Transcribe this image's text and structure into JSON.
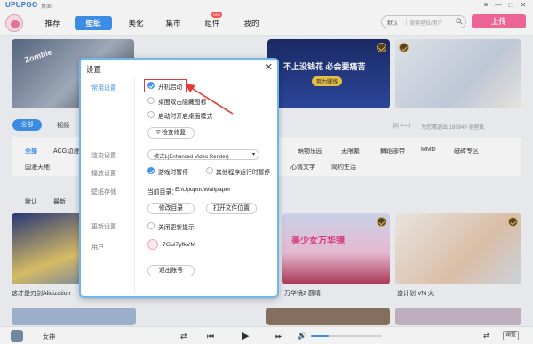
{
  "app": {
    "logo": "UPUPOO",
    "subtitle": "桌面",
    "window_controls": [
      "≡",
      "—",
      "□",
      "✕"
    ]
  },
  "nav": {
    "items": [
      {
        "label": "推荐"
      },
      {
        "label": "壁纸",
        "active": true
      },
      {
        "label": "美化"
      },
      {
        "label": "集市"
      },
      {
        "label": "组件",
        "badge": "new"
      },
      {
        "label": "我的"
      }
    ]
  },
  "search": {
    "filter": "默认",
    "placeholder": "搜索壁纸/用户"
  },
  "upload_label": "上传",
  "banner": {
    "text1": "不上没钱花 必会要痛苦",
    "text2": "努力赚钱",
    "text3": "Zombie"
  },
  "tabs": {
    "all": "全部",
    "video": "视频"
  },
  "info_right": "为您精选出 185949 张壁纸",
  "stat_right": "[3] ⟵1",
  "categories": {
    "row1": [
      {
        "label": "全部",
        "active": true
      },
      "ACG动漫",
      "萌物乐园",
      "无限繁",
      "舞蹈部带",
      "MMD",
      "磁砖专区"
    ],
    "row2": [
      "国漫天地",
      "心情文字",
      "简约生活"
    ]
  },
  "sort": [
    "默认",
    "最新"
  ],
  "captions": [
    "这才是刃剑Alicization",
    "万华镜2 蔚晴",
    "逆计划 VN 火"
  ],
  "card_text": "美少女万华镜",
  "player": {
    "track": "女神",
    "controls": {
      "prev": "⏮",
      "play": "▶",
      "next": "⏭",
      "shuffle": "⇄"
    },
    "volume_icon": "🔊",
    "volume_level": 0.25,
    "extra": "调整"
  },
  "dialog": {
    "title": "设置",
    "close": "✕",
    "nav": [
      "常用设置",
      "渲染设置",
      "播放设置",
      "壁纸存储",
      "更新设置",
      "用户"
    ],
    "options": {
      "startup": "开机启动",
      "desktop_hide": "桌面双击隐藏图标",
      "start_minimized": "启动时开启桌面模式",
      "repair_button": "检查修复",
      "render_select": "模式1(Enhanced Video Render)",
      "pause_game": "游戏时暂停",
      "pause_other": "其他程序运行时暂停",
      "dir_label": "当前目录：",
      "dir_value": "E:\\UpupooWallpaper",
      "change_dir": "修改目录",
      "open_dir": "打开文件位置",
      "close_update": "关闭更新提示",
      "username": "7Gui7yfkVM",
      "logout": "退出账号"
    },
    "checked": {
      "startup": true,
      "pause_game": true
    }
  }
}
